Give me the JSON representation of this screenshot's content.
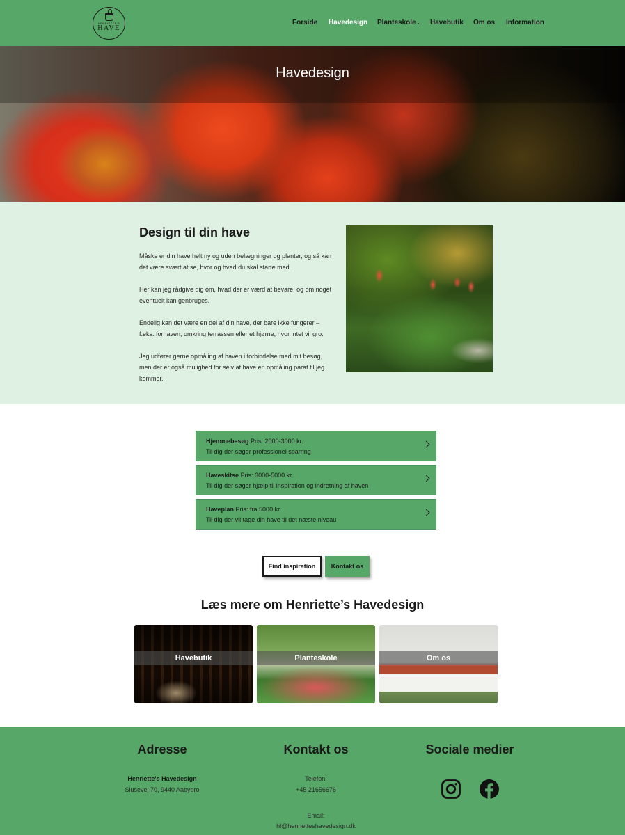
{
  "header": {
    "logo": {
      "small_text": "HENRIETTE'S",
      "big_text": "HAVE"
    },
    "nav": [
      {
        "label": "Forside",
        "active": false
      },
      {
        "label": "Havedesign",
        "active": true
      },
      {
        "label": "Planteskole",
        "active": false,
        "has_dropdown": true
      },
      {
        "label": "Havebutik",
        "active": false
      },
      {
        "label": "Om os",
        "active": false
      },
      {
        "label": "Information",
        "active": false
      }
    ]
  },
  "hero": {
    "title": "Havedesign"
  },
  "intro": {
    "heading": "Design til din have",
    "paragraphs": [
      [
        "Måske er din have helt ny og uden belægninger og planter, og så kan",
        "det være svært at se, hvor og hvad du skal starte med."
      ],
      [
        "Her kan jeg rådgive dig om, hvad der er værd at bevare, og om noget",
        "eventuelt kan genbruges."
      ],
      [
        "Endelig kan det være en del af din have, der bare ikke fungerer –",
        "f.eks. forhaven, omkring terrassen eller et hjørne, hvor intet vil gro."
      ],
      [
        "Jeg udfører gerne opmåling af haven i forbindelse med mit besøg,",
        "men der er også mulighed for selv at have en opmåling parat til jeg",
        "kommer."
      ]
    ]
  },
  "services": [
    {
      "name": "Hjemmebesøg",
      "price": "Pris: 2000-3000 kr.",
      "description": "Til dig der søger professionel sparring"
    },
    {
      "name": "Haveskitse",
      "price": "Pris: 3000-5000 kr.",
      "description": "Til dig der søger hjælp til inspiration og indretning af haven"
    },
    {
      "name": "Haveplan",
      "price": "Pris: fra 5000 kr.",
      "description": "Til dig der vil tage din have til det næste niveau"
    }
  ],
  "buttons": {
    "inspiration": "Find inspiration",
    "contact": "Kontakt os"
  },
  "readmore": {
    "title": "Læs mere om Henriette’s Havedesign",
    "cards": [
      {
        "label": "Havebutik"
      },
      {
        "label": "Planteskole"
      },
      {
        "label": "Om os"
      }
    ]
  },
  "footer": {
    "address": {
      "title": "Adresse",
      "name": "Henriette's Havedesign",
      "street": "Slusevej 70, 9440 Aabybro"
    },
    "contact": {
      "title": "Kontakt os",
      "phone_label": "Telefon:",
      "phone": "+45 21656676",
      "email_label": "Email:",
      "email": "hl@henrietteshavedesign.dk"
    },
    "social": {
      "title": "Sociale medier",
      "icons": [
        "instagram-icon",
        "facebook-icon"
      ]
    }
  },
  "colors": {
    "brand_green": "#57a768",
    "light_green": "#dff1e2",
    "text": "#1a1a1a"
  }
}
